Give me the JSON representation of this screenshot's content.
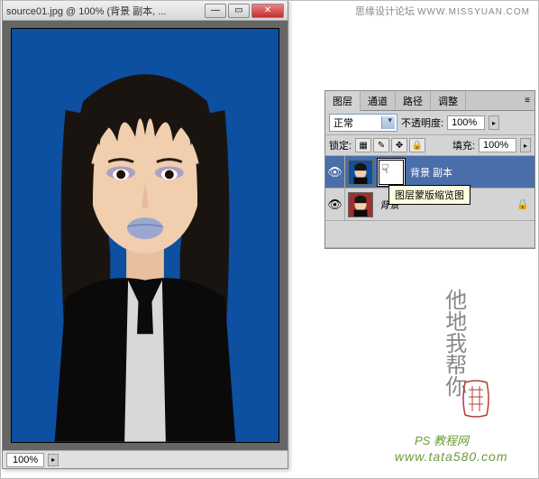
{
  "window": {
    "title": "source01.jpg @ 100% (背景 副本, ...",
    "zoom": "100%"
  },
  "forum": {
    "name": "思缘设计论坛",
    "url": "WWW.MISSYUAN.COM"
  },
  "panel": {
    "tabs": [
      "图层",
      "通道",
      "路径",
      "调整"
    ],
    "blend_mode": "正常",
    "opacity_label": "不透明度:",
    "opacity_value": "100%",
    "lock_label": "锁定:",
    "fill_label": "填充:",
    "fill_value": "100%"
  },
  "layers": [
    {
      "name": "背景 副本",
      "visible": true,
      "selected": true,
      "has_mask": true
    },
    {
      "name": "背景",
      "visible": true,
      "selected": false,
      "locked": true
    }
  ],
  "tooltip": "图层蒙版缩览图",
  "watermark": {
    "script": "他地我帮你",
    "line1": "PS 教程网",
    "line2": "www.tata580.com"
  }
}
